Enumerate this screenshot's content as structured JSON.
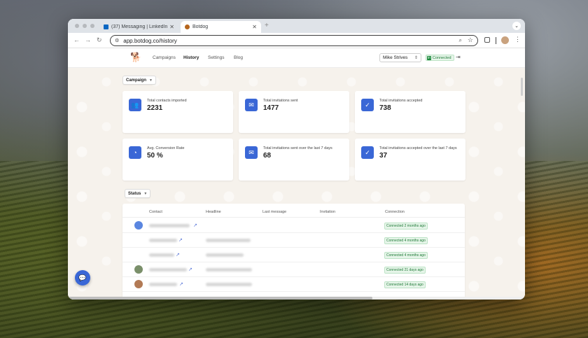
{
  "browser": {
    "tabs": [
      {
        "title": "(37) Messaging | LinkedIn",
        "favicon": "linkedin-icon",
        "active": false
      },
      {
        "title": "Botdog",
        "favicon": "botdog-dog-icon",
        "active": true
      }
    ],
    "url": "app.botdog.co/history"
  },
  "nav": {
    "links": [
      "Campaigns",
      "History",
      "Settings",
      "Blog"
    ],
    "active": "History",
    "user": "Mike Strives",
    "connection_status": "Connected"
  },
  "filters": {
    "campaign": "Campaign",
    "status": "Status"
  },
  "stats": [
    {
      "label": "Total contacts imported",
      "value": "2231",
      "icon": "contacts-icon"
    },
    {
      "label": "Total invitations sent",
      "value": "1477",
      "icon": "envelope-open-icon"
    },
    {
      "label": "Total invitations accepted",
      "value": "738",
      "icon": "check-circle-icon"
    },
    {
      "label": "Avg. Conversion Rate",
      "value": "50 %",
      "icon": "pie-chart-icon"
    },
    {
      "label": "Total invitations sent over the last 7 days",
      "value": "68",
      "icon": "envelope-open-icon"
    },
    {
      "label": "Total invitations accepted over the last 7 days",
      "value": "37",
      "icon": "check-circle-icon"
    }
  ],
  "table": {
    "columns": [
      "Contact",
      "Headline",
      "Last message",
      "Invitation",
      "Connection"
    ],
    "rows": [
      {
        "connection": "Connected 2 months ago"
      },
      {
        "connection": "Connected 4 months ago"
      },
      {
        "connection": "Connected 4 months ago"
      },
      {
        "connection": "Connected 21 days ago"
      },
      {
        "connection": "Connected 14 days ago"
      }
    ]
  },
  "colors": {
    "accent": "#3a67d6",
    "success": "#1f7a37",
    "app_background": "#f6f2ec"
  }
}
